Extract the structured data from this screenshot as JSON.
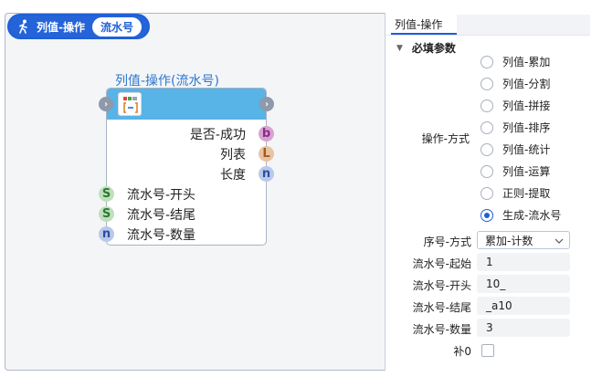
{
  "header": {
    "title": "列值-操作",
    "badge": "流水号"
  },
  "node": {
    "title": "列值-操作(流水号)",
    "outputs": [
      {
        "label": "是否-成功",
        "type": "b",
        "color": "#c070b8"
      },
      {
        "label": "列表",
        "type": "L",
        "color": "#c8895a"
      },
      {
        "label": "长度",
        "type": "n",
        "color": "#7a9ad6"
      }
    ],
    "inputs": [
      {
        "label": "流水号-开头",
        "type": "S",
        "color": "#7cbf7c"
      },
      {
        "label": "流水号-结尾",
        "type": "S",
        "color": "#7cbf7c"
      },
      {
        "label": "流水号-数量",
        "type": "n",
        "color": "#7a9ad6"
      }
    ]
  },
  "panel": {
    "tab": "列值-操作",
    "section": "必填参数",
    "op_label": "操作-方式",
    "options": [
      "列值-累加",
      "列值-分割",
      "列值-拼接",
      "列值-排序",
      "列值-统计",
      "列值-运算",
      "正则-提取",
      "生成-流水号"
    ],
    "selected_index": 7,
    "seq_label": "序号-方式",
    "seq_value": "累加-计数",
    "fields": [
      {
        "label": "流水号-起始",
        "value": "1"
      },
      {
        "label": "流水号-开头",
        "value": "10_"
      },
      {
        "label": "流水号-结尾",
        "value": "_a10"
      },
      {
        "label": "流水号-数量",
        "value": "3"
      }
    ],
    "pad_label": "补0",
    "pad_checked": false
  }
}
